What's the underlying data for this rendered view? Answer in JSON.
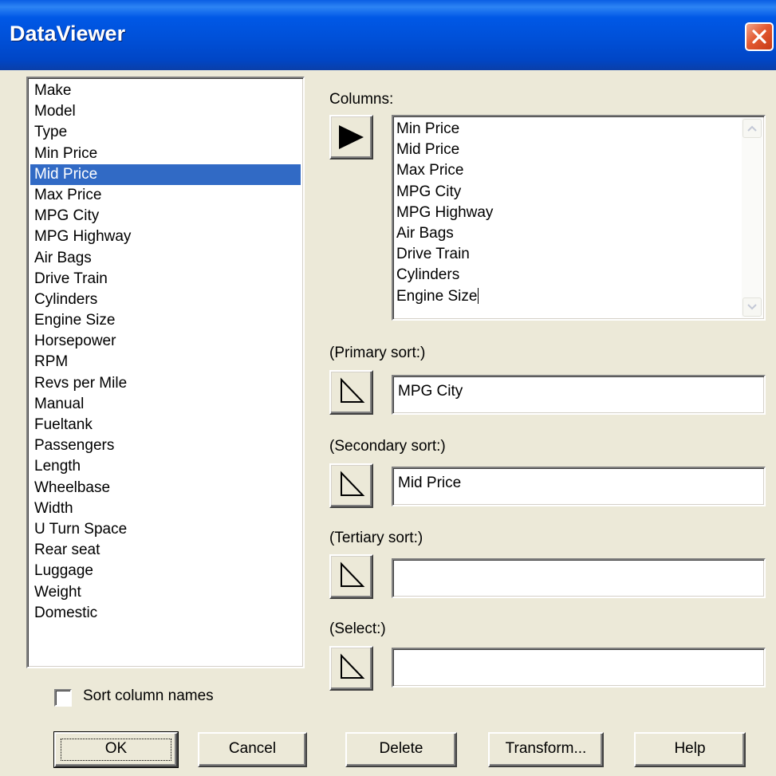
{
  "window": {
    "title": "DataViewer"
  },
  "variables": {
    "items": [
      "Make",
      "Model",
      "Type",
      "Min Price",
      "Mid Price",
      "Max Price",
      "MPG City",
      "MPG Highway",
      "Air Bags",
      "Drive Train",
      "Cylinders",
      "Engine Size",
      "Horsepower",
      "RPM",
      "Revs per Mile",
      "Manual",
      "Fueltank",
      "Passengers",
      "Length",
      "Wheelbase",
      "Width",
      "U Turn Space",
      "Rear seat",
      "Luggage",
      "Weight",
      "Domestic"
    ],
    "selected": "Mid Price"
  },
  "columns": {
    "label": "Columns:",
    "items": [
      "Min Price",
      "Mid Price",
      "Max Price",
      "MPG City",
      "MPG Highway",
      "Air Bags",
      "Drive Train",
      "Cylinders",
      "Engine Size"
    ]
  },
  "primary_sort": {
    "label": "(Primary sort:)",
    "value": "MPG City"
  },
  "secondary_sort": {
    "label": "(Secondary sort:)",
    "value": "Mid Price"
  },
  "tertiary_sort": {
    "label": "(Tertiary sort:)",
    "value": ""
  },
  "select": {
    "label": "(Select:)",
    "value": ""
  },
  "sort_column_names": {
    "label": "Sort column names",
    "checked": false
  },
  "buttons": {
    "ok": "OK",
    "cancel": "Cancel",
    "delete": "Delete",
    "transform": "Transform...",
    "help": "Help"
  },
  "colors": {
    "title_bar": "#0055e5",
    "selection": "#316ac5",
    "dialog_bg": "#ece9d8",
    "close_button": "#e35a31"
  },
  "icons": {
    "add": "play-arrow-icon",
    "sort_arrow": "outline-triangle-icon",
    "close": "close-x-icon"
  }
}
